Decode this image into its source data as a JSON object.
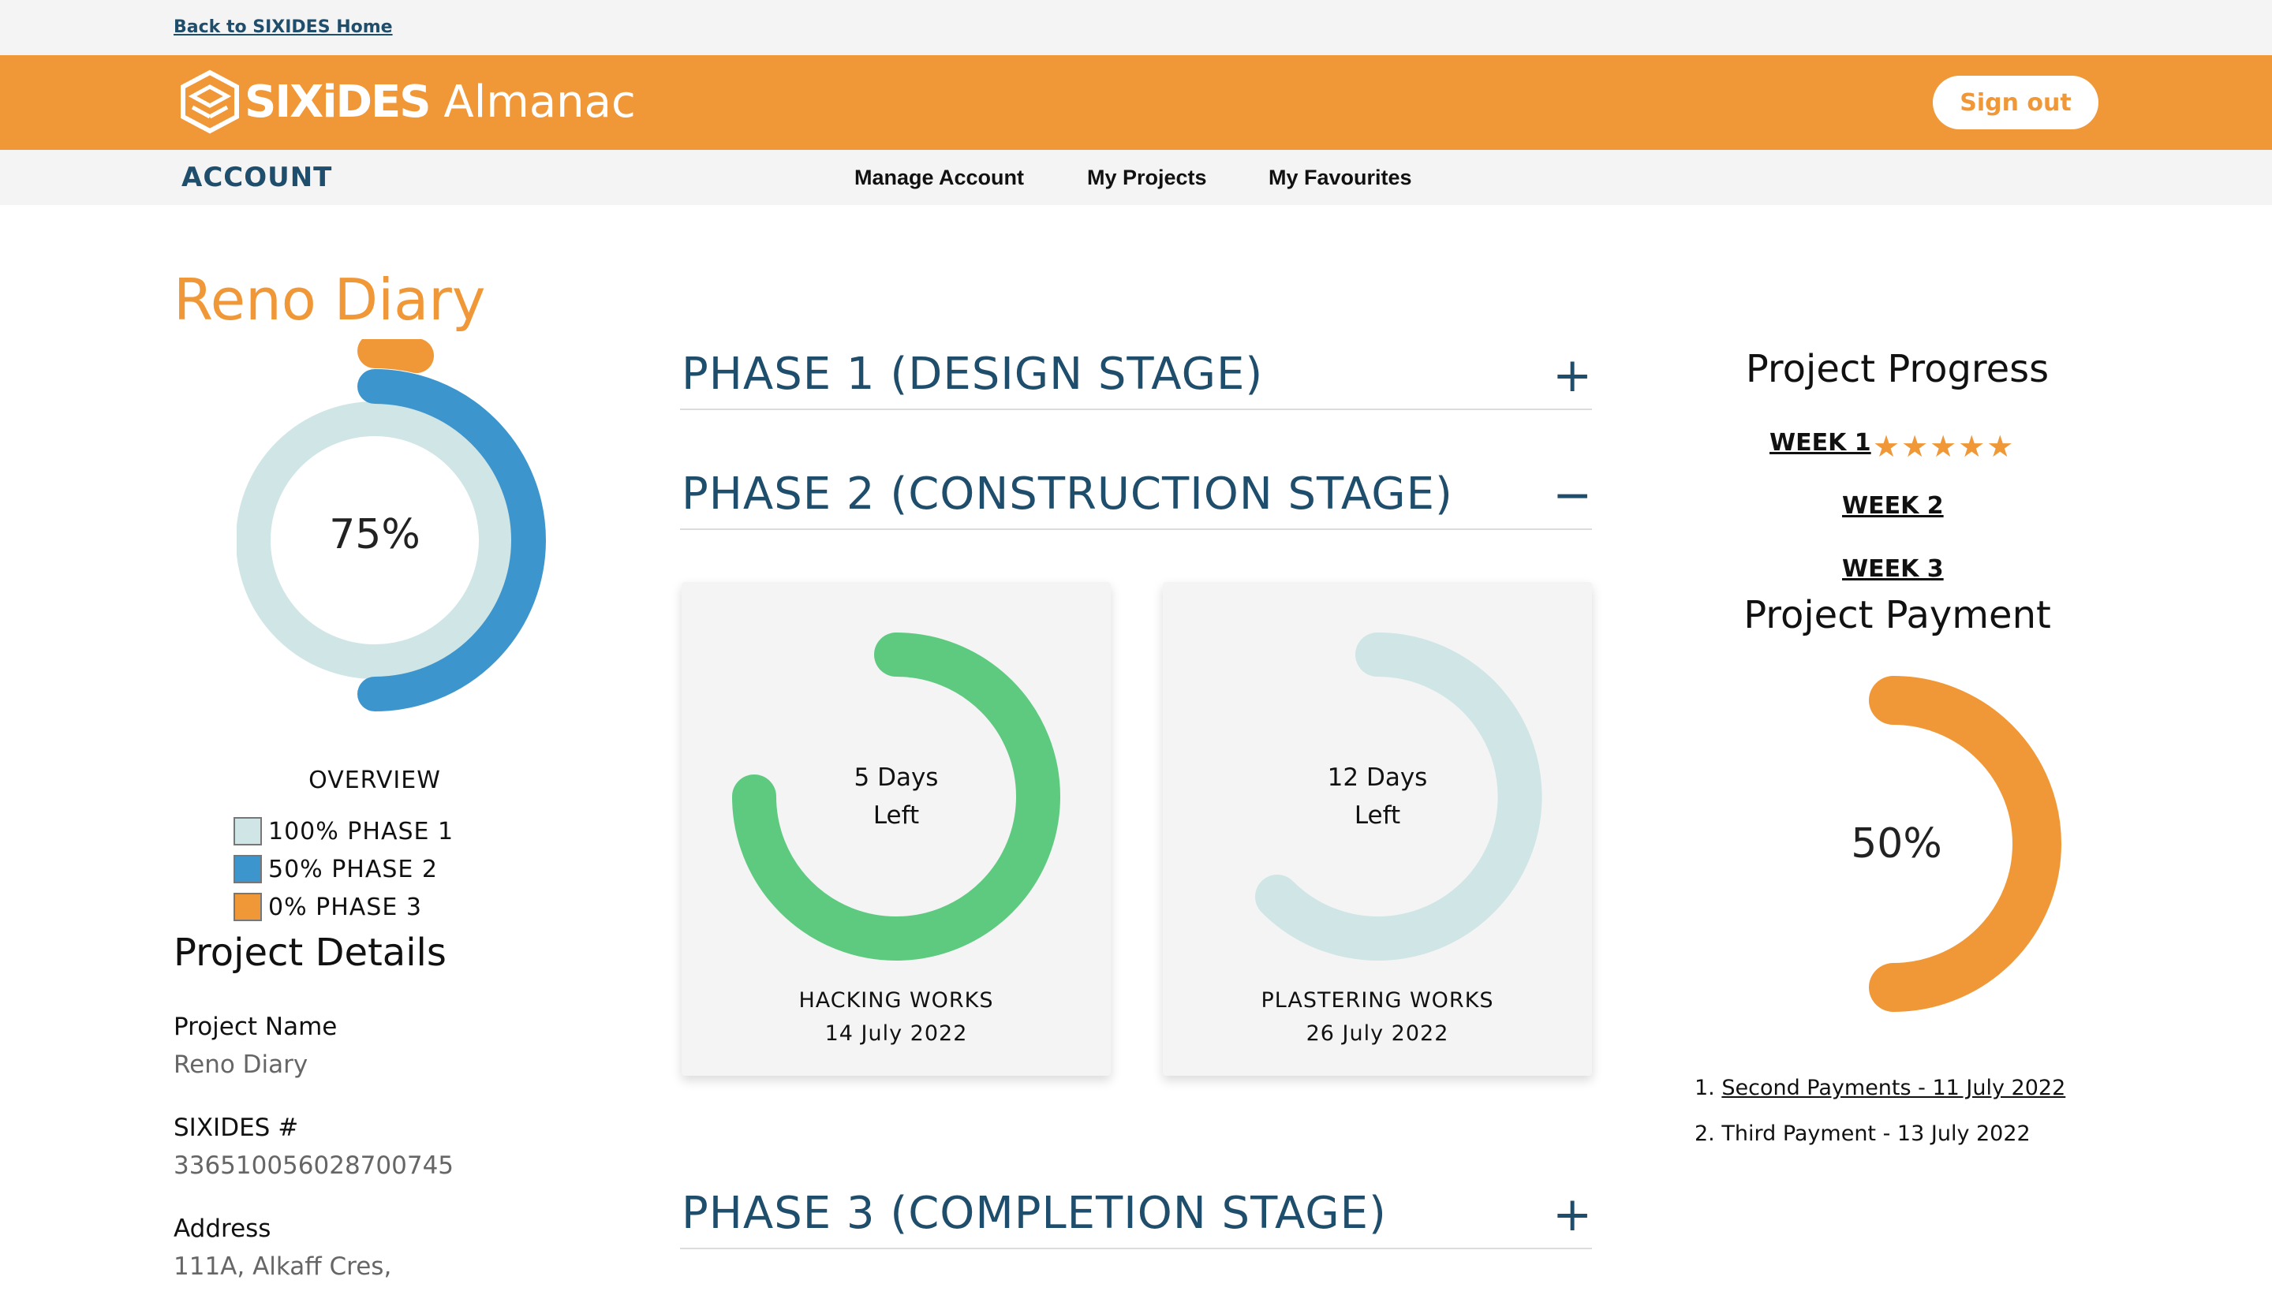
{
  "topbar": {
    "back_link": "Back to SIXIDES Home"
  },
  "header": {
    "brand_bold": "SIXiDES",
    "brand_light": "Almanac",
    "signout_label": "Sign out"
  },
  "subnav": {
    "section": "ACCOUNT",
    "links": [
      "Manage Account",
      "My Projects",
      "My Favourites"
    ]
  },
  "page_title": "Reno Diary",
  "overview": {
    "progress_label": "75%",
    "title": "OVERVIEW",
    "legend": [
      {
        "label": "100% PHASE 1",
        "color": "#cfe5e6",
        "percent": 100
      },
      {
        "label": "50% PHASE 2",
        "color": "#3d95cd",
        "percent": 50
      },
      {
        "label": "0% PHASE 3",
        "color": "#f09838",
        "percent": 0
      }
    ]
  },
  "project_details": {
    "title": "Project Details",
    "fields": [
      {
        "label": "Project Name",
        "value": "Reno Diary"
      },
      {
        "label": "SIXIDES #",
        "value": "336510056028700745"
      },
      {
        "label": "Address",
        "value": "111A, Alkaff Cres,"
      }
    ]
  },
  "phases": [
    {
      "title": "PHASE 1 (DESIGN STAGE)",
      "toggle": "+"
    },
    {
      "title": "PHASE 2 (CONSTRUCTION STAGE)",
      "toggle": "−"
    },
    {
      "title": "PHASE 3 (COMPLETION STAGE)",
      "toggle": "+"
    }
  ],
  "tasks": [
    {
      "days_line1": "5 Days",
      "days_line2": "Left",
      "name": "HACKING WORKS",
      "date": "14 July 2022",
      "color": "#5dca80",
      "fill": 0.75
    },
    {
      "days_line1": "12 Days",
      "days_line2": "Left",
      "name": "PLASTERING WORKS",
      "date": "26 July 2022",
      "color": "#cfe5e6",
      "fill": 0.625
    }
  ],
  "progress": {
    "title": "Project Progress",
    "weeks": [
      "WEEK 1",
      "WEEK 2",
      "WEEK 3"
    ],
    "week1_stars": "★★★★★",
    "week1_rating": 5
  },
  "payment": {
    "title": "Project Payment",
    "percent_label": "50%",
    "fill": 0.5,
    "items": [
      {
        "num": "1.",
        "text": "Second Payments - 11 July 2022",
        "link": true
      },
      {
        "num": "2.",
        "text": "Third Payment - 13 July 2022",
        "link": false
      }
    ]
  },
  "colors": {
    "brand": "#f09838",
    "navy": "#1f4e6c",
    "phase2": "#3d95cd",
    "phase1": "#cfe5e6",
    "green": "#5dca80"
  }
}
